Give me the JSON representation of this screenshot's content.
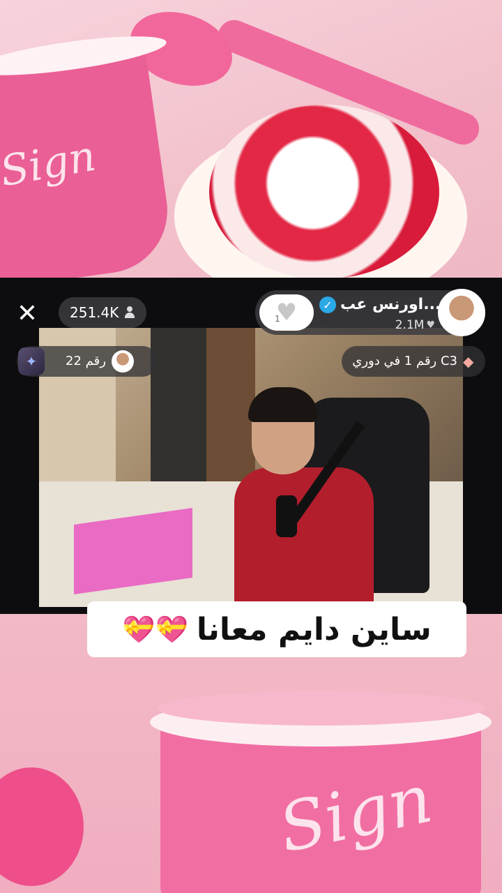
{
  "background": {
    "top_cup_text": "Sign",
    "bottom_cup_text": "Sign",
    "accent_pink": "#ea5f95"
  },
  "header": {
    "close_icon": "close-icon",
    "viewer_count": "251.4K",
    "host_name": "اورنس عب...",
    "host_likes": "2.1M",
    "gift_count": "1",
    "verified_color": "#2ba8e6"
  },
  "ranks": {
    "left_label": "رقم 22",
    "right_label": "رقم 1 في دوري C3"
  },
  "caption": {
    "text": "ساين دايم معانا",
    "emoji": "💝💝"
  }
}
